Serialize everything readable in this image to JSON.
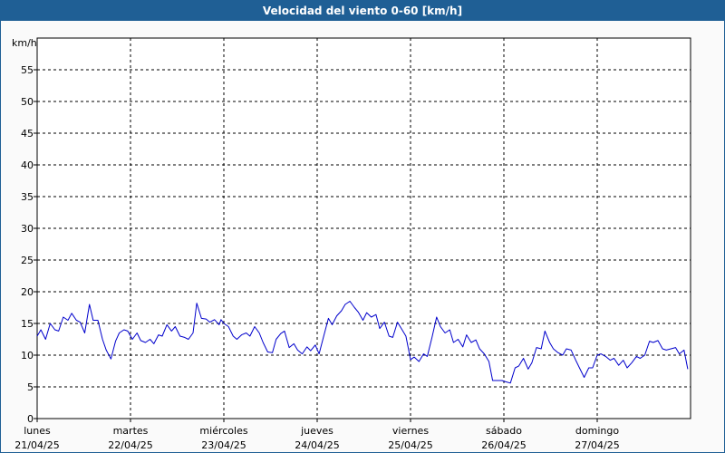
{
  "window": {
    "title": "Velocidad del viento 0-60 [km/h]"
  },
  "chart_data": {
    "type": "line",
    "title": "Velocidad del viento 0-60 [km/h]",
    "ylabel": "km/h",
    "ylim": [
      0,
      60
    ],
    "yticks": [
      0,
      5,
      10,
      15,
      20,
      25,
      30,
      35,
      40,
      45,
      50,
      55
    ],
    "xlim": [
      0,
      7
    ],
    "grid": true,
    "x_ticks": [
      {
        "pos": 0,
        "day": "lunes",
        "date": "21/04/25"
      },
      {
        "pos": 1,
        "day": "martes",
        "date": "22/04/25"
      },
      {
        "pos": 2,
        "day": "miércoles",
        "date": "23/04/25"
      },
      {
        "pos": 3,
        "day": "jueves",
        "date": "24/04/25"
      },
      {
        "pos": 4,
        "day": "viernes",
        "date": "25/04/25"
      },
      {
        "pos": 5,
        "day": "sábado",
        "date": "26/04/25"
      },
      {
        "pos": 6,
        "day": "domingo",
        "date": "27/04/25"
      }
    ],
    "series": [
      {
        "color": "#0000cc",
        "x": [
          0.0,
          0.04,
          0.09,
          0.14,
          0.19,
          0.23,
          0.28,
          0.33,
          0.37,
          0.42,
          0.46,
          0.51,
          0.56,
          0.6,
          0.65,
          0.7,
          0.74,
          0.79,
          0.84,
          0.88,
          0.93,
          0.97,
          1.02,
          1.07,
          1.11,
          1.16,
          1.21,
          1.25,
          1.3,
          1.34,
          1.39,
          1.44,
          1.48,
          1.53,
          1.58,
          1.62,
          1.67,
          1.71,
          1.76,
          1.81,
          1.85,
          1.9,
          1.95,
          1.97,
          2.0,
          2.05,
          2.1,
          2.14,
          2.19,
          2.24,
          2.28,
          2.33,
          2.38,
          2.42,
          2.47,
          2.52,
          2.56,
          2.61,
          2.65,
          2.7,
          2.75,
          2.79,
          2.84,
          2.89,
          2.93,
          2.98,
          3.02,
          3.07,
          3.12,
          3.16,
          3.21,
          3.26,
          3.3,
          3.35,
          3.4,
          3.44,
          3.49,
          3.53,
          3.58,
          3.63,
          3.67,
          3.72,
          3.77,
          3.81,
          3.86,
          3.91,
          3.95,
          4.0,
          4.04,
          4.09,
          4.14,
          4.18,
          4.23,
          4.28,
          4.32,
          4.37,
          4.42,
          4.46,
          4.51,
          4.56,
          4.6,
          4.65,
          4.7,
          4.74,
          4.79,
          4.84,
          4.88,
          4.93,
          4.95,
          4.98,
          5.02,
          5.07,
          5.12,
          5.16,
          5.21,
          5.26,
          5.3,
          5.35,
          5.4,
          5.44,
          5.49,
          5.53,
          5.58,
          5.63,
          5.67,
          5.72,
          5.77,
          5.81,
          5.86,
          5.91,
          5.95,
          6.0,
          6.04,
          6.09,
          6.14,
          6.18,
          6.23,
          6.28,
          6.32,
          6.37,
          6.42,
          6.46,
          6.51,
          6.56,
          6.6,
          6.65,
          6.7,
          6.74,
          6.79,
          6.84,
          6.88,
          6.93,
          6.97
        ],
        "values": [
          13.0,
          14.0,
          12.5,
          15.0,
          14.0,
          13.8,
          16.0,
          15.5,
          16.6,
          15.5,
          15.2,
          13.5,
          18.0,
          15.5,
          15.5,
          12.5,
          10.8,
          9.4,
          12.2,
          13.5,
          14.0,
          13.8,
          12.5,
          13.5,
          12.3,
          12.0,
          12.5,
          11.8,
          13.2,
          13.0,
          14.8,
          13.8,
          14.5,
          13.0,
          12.8,
          12.5,
          13.5,
          18.2,
          15.8,
          15.7,
          15.2,
          15.6,
          14.8,
          15.6,
          15.0,
          14.5,
          13.0,
          12.5,
          13.2,
          13.5,
          13.0,
          14.5,
          13.5,
          12.0,
          10.5,
          10.4,
          12.5,
          13.4,
          13.8,
          11.2,
          11.8,
          10.8,
          10.2,
          11.3,
          10.7,
          11.6,
          10.2,
          13.0,
          15.8,
          14.8,
          16.2,
          17.0,
          18.0,
          18.5,
          17.5,
          16.8,
          15.5,
          16.7,
          16.0,
          16.4,
          14.2,
          15.2,
          13.0,
          12.8,
          15.2,
          14.0,
          13.0,
          9.3,
          9.7,
          9.0,
          10.2,
          9.8,
          12.8,
          16.0,
          14.5,
          13.5,
          14.0,
          12.0,
          12.5,
          11.3,
          13.2,
          12.0,
          12.4,
          11.0,
          10.2,
          9.0,
          6.0,
          6.0,
          6.0,
          6.0,
          5.8,
          5.6,
          8.0,
          8.3,
          9.5,
          7.8,
          8.8,
          11.2,
          11.0,
          13.8,
          12.0,
          11.0,
          10.4,
          10.0,
          11.0,
          10.8,
          9.2,
          8.0,
          6.5,
          8.0,
          8.0,
          10.0,
          10.2,
          9.8,
          9.2,
          9.5,
          8.4,
          9.2,
          8.0,
          8.8,
          9.8,
          9.5,
          10.0,
          12.2,
          12.0,
          12.3,
          11.0,
          10.8,
          11.0,
          11.2,
          10.2,
          10.8,
          7.8
        ]
      }
    ]
  }
}
